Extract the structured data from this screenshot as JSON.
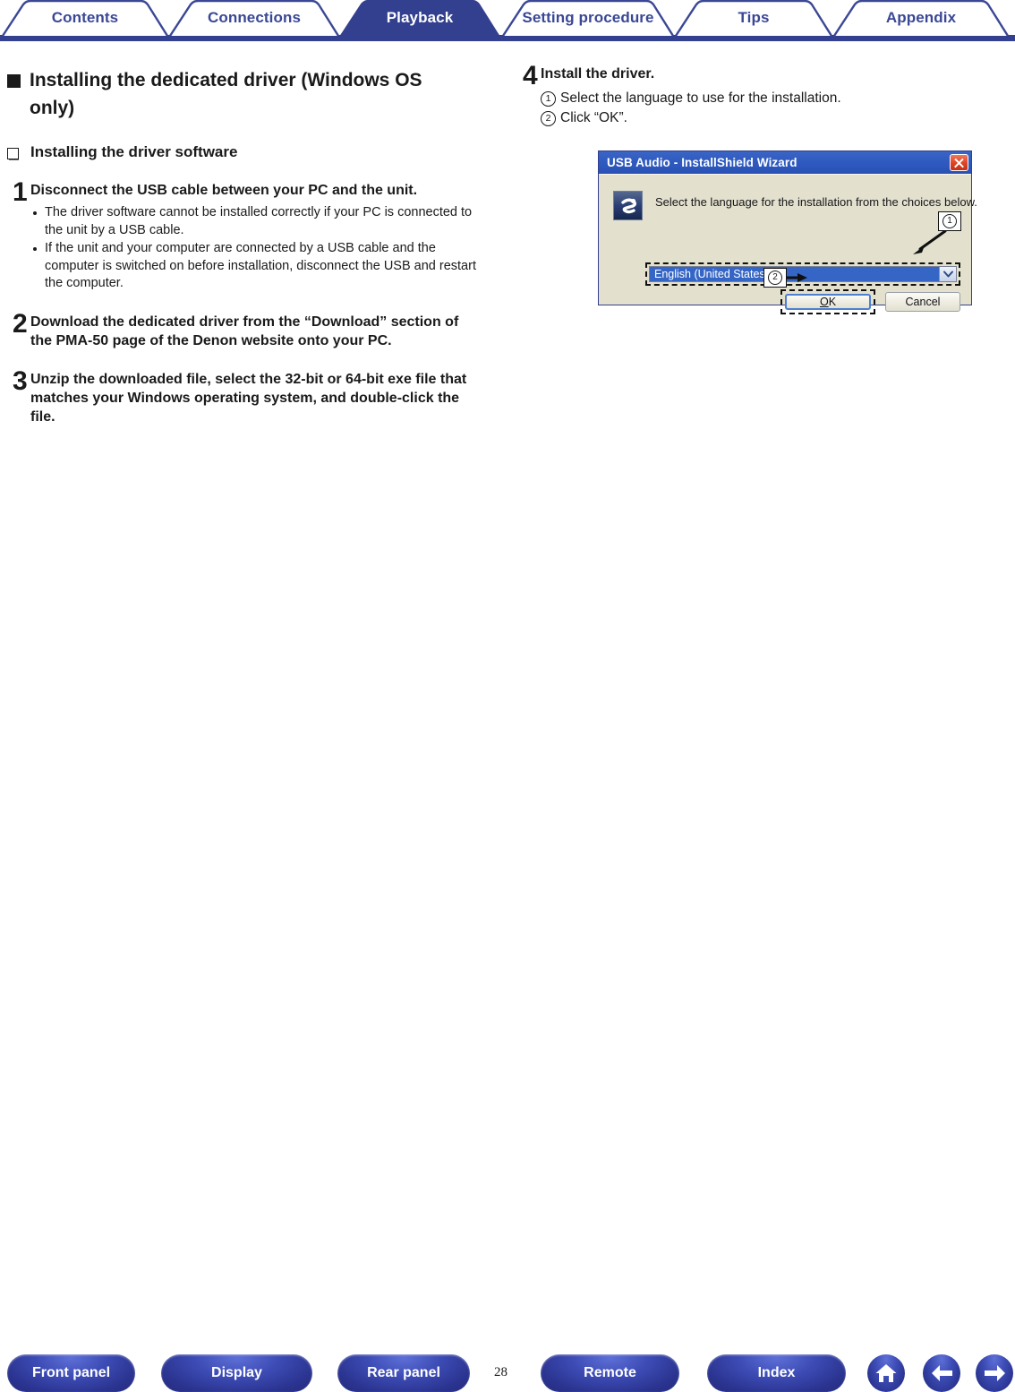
{
  "tabs": [
    {
      "label": "Contents",
      "active": false
    },
    {
      "label": "Connections",
      "active": false
    },
    {
      "label": "Playback",
      "active": true
    },
    {
      "label": "Setting procedure",
      "active": false
    },
    {
      "label": "Tips",
      "active": false
    },
    {
      "label": "Appendix",
      "active": false
    }
  ],
  "left": {
    "heading": "Installing the dedicated driver (Windows OS only)",
    "subheading": "Installing the driver software",
    "steps": [
      {
        "num": "1",
        "title": "Disconnect the USB cable between your PC and the unit.",
        "notes": [
          "The driver software cannot be installed correctly if your PC is connected to the unit by a USB cable.",
          "If the unit and your computer are connected by a USB cable and the computer is switched on before installation, disconnect the USB and restart the computer."
        ]
      },
      {
        "num": "2",
        "title": "Download the dedicated driver from the “Download” section of the PMA-50 page of the Denon website onto your PC.",
        "notes": []
      },
      {
        "num": "3",
        "title": "Unzip the downloaded file, select the 32-bit or 64-bit exe file that matches your Windows operating system, and double-click the file.",
        "notes": []
      }
    ]
  },
  "right": {
    "step": {
      "num": "4",
      "title": "Install the driver.",
      "substeps": [
        {
          "marker": "1",
          "text": "Select the language to use for the installation."
        },
        {
          "marker": "2",
          "text": "Click “OK”."
        }
      ]
    },
    "dialog": {
      "title": "USB Audio - InstallShield Wizard",
      "close_label": "×",
      "message": "Select the language for the installation from the choices below.",
      "combo_value": "English (United States)",
      "ok_label": "OK",
      "ok_mnemonic": "O",
      "ok_rest": "K",
      "cancel_label": "Cancel",
      "callout_1": "1",
      "callout_2": "2"
    }
  },
  "bottom": {
    "buttons": [
      {
        "label": "Front panel"
      },
      {
        "label": "Display"
      },
      {
        "label": "Rear panel"
      },
      {
        "label": "Remote"
      },
      {
        "label": "Index"
      }
    ],
    "page_number": "28",
    "icons": [
      "home-icon",
      "arrow-left-icon",
      "arrow-right-icon"
    ]
  },
  "colors": {
    "brand_blue": "#33408f",
    "tab_text": "#3a4795",
    "dialog_bg": "#e3e1cd",
    "dialog_title": "#2f5bc0",
    "select_blue": "#3566c6"
  }
}
